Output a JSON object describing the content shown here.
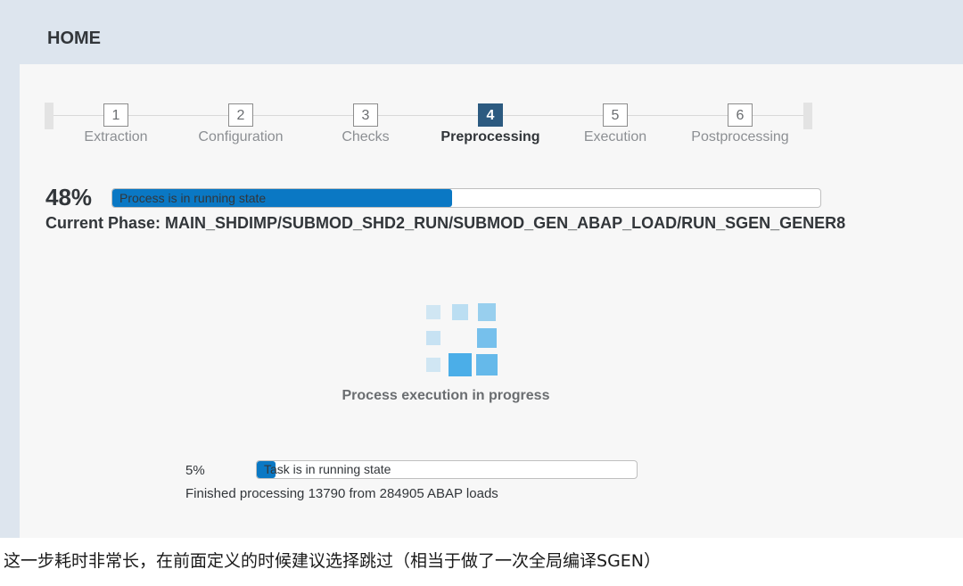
{
  "header": {
    "title": "HOME"
  },
  "wizard": {
    "steps": [
      {
        "number": "1",
        "label": "Extraction"
      },
      {
        "number": "2",
        "label": "Configuration"
      },
      {
        "number": "3",
        "label": "Checks"
      },
      {
        "number": "4",
        "label": "Preprocessing"
      },
      {
        "number": "5",
        "label": "Execution"
      },
      {
        "number": "6",
        "label": "Postprocessing"
      }
    ],
    "active_step": "4"
  },
  "main_progress": {
    "percent_label": "48%",
    "percent": 48,
    "bar_text": "Process is in running state",
    "bar_color": "#0a78c4"
  },
  "phase": {
    "text": "Current Phase: MAIN_SHDIMP/SUBMOD_SHD2_RUN/SUBMOD_GEN_ABAP_LOAD/RUN_SGEN_GENER8"
  },
  "loader": {
    "icon": "busy-indicator-icon",
    "text": "Process execution in progress",
    "color": "#4baee8"
  },
  "task_progress": {
    "percent_label": "5%",
    "percent": 5,
    "bar_text": "Task is in running state",
    "status": "Finished processing 13790 from 284905 ABAP loads"
  },
  "caption": {
    "text": "这一步耗时非常长，在前面定义的时候建议选择跳过（相当于做了一次全局编译SGEN）"
  }
}
